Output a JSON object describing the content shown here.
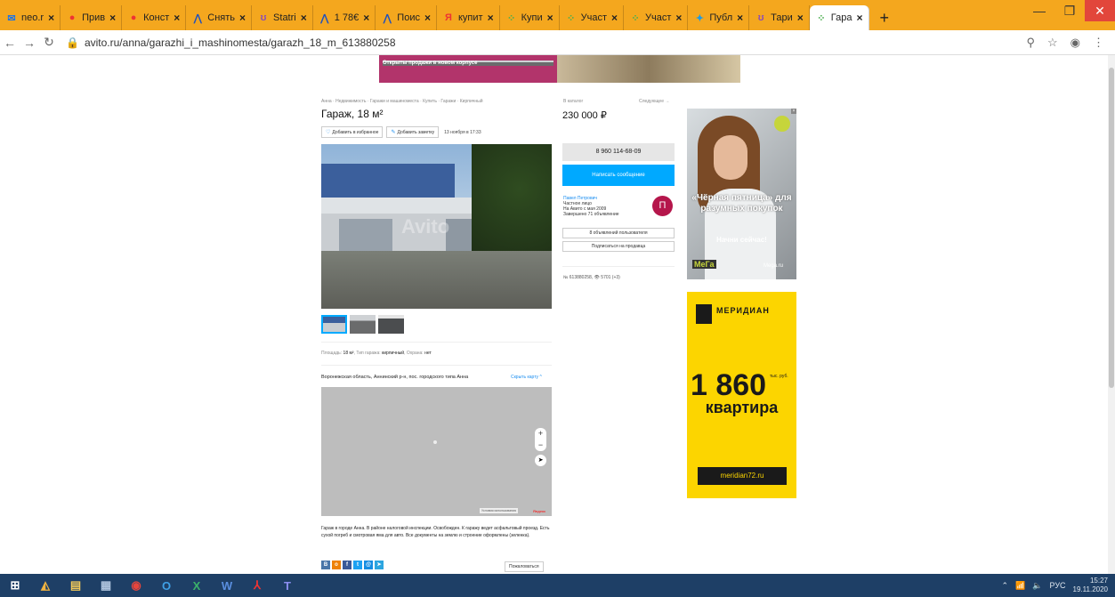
{
  "tabs": [
    {
      "icon": "mail-icon",
      "label": "neo.r",
      "active": false
    },
    {
      "icon": "pin-icon",
      "label": "Прив",
      "active": false
    },
    {
      "icon": "pin-icon",
      "label": "Конст",
      "active": false
    },
    {
      "icon": "avito-icon",
      "label": "Снять",
      "active": false
    },
    {
      "icon": "statrix-icon",
      "label": "Statri",
      "active": false
    },
    {
      "icon": "avito-icon",
      "label": "1 78€",
      "active": false
    },
    {
      "icon": "avito-icon",
      "label": "Поис",
      "active": false
    },
    {
      "icon": "yandex-icon",
      "label": "купит",
      "active": false
    },
    {
      "icon": "dots-icon",
      "label": "Купи",
      "active": false
    },
    {
      "icon": "dots-icon",
      "label": "Участ",
      "active": false
    },
    {
      "icon": "dots-icon",
      "label": "Участ",
      "active": false
    },
    {
      "icon": "star-icon",
      "label": "Публ",
      "active": false
    },
    {
      "icon": "statrix-icon",
      "label": "Тари",
      "active": false
    },
    {
      "icon": "dots-icon",
      "label": "Гара",
      "active": true
    }
  ],
  "browser": {
    "url": "avito.ru/anna/garazhi_i_mashinomesta/garazh_18_m_613880258"
  },
  "banner": {
    "line1": "Открыты продажи в новом корпусе"
  },
  "listing": {
    "breadcrumb": "Анна · Недвижимость · Гаражи и машиноместа · Купить · Гаражи · Кирпичный",
    "title": "Гараж, 18 м²",
    "fav_label": "Добавить в избранное",
    "note_label": "Добавить заметку",
    "date": "13 ноября в 17:33",
    "photo_watermark": "Avito",
    "params_label1": "Площадь:",
    "params_value1": "18 м²",
    "params_label2": "Тип гаража:",
    "params_value2": "кирпичный",
    "params_label3": "Охрана:",
    "params_value3": "нет",
    "address": "Воронежская область, Аннинский р-н, пос. городского типа Анна",
    "hide_map": "Скрыть карту ^",
    "map_terms": "Условия использования",
    "map_logo": "Яндекс",
    "description": "Гараж в городе Анна. В районе налоговой инспекции. Освобожден. К гаражу ведет асфальтовый проезд. Есть сухой погреб и смотровая яма для авто. Все документы на землю и строение оформлены (зеленка).",
    "complain": "Пожаловаться"
  },
  "sidebar": {
    "catalog": "В каталог",
    "next": "Следующее →",
    "price": "230 000 ₽",
    "phone": "8 960 114-68-09",
    "message_btn": "Написать сообщение",
    "seller_name": "Павел Петрович",
    "seller_type": "Частное лицо",
    "seller_since": "На Авито с мая 2009",
    "seller_done": "Завершено 71 объявление",
    "avatar_letter": "П",
    "ads_btn": "8 объявлений пользователя",
    "subscribe_btn": "Подписаться на продавца",
    "ad_id": "№ 613880258, 👁 5701 (+3)"
  },
  "ads": {
    "mega_text": "«Чёрная пятница» для разумных покупок",
    "mega_cta": "Начни сейчас!",
    "mega_logo": "МеГа",
    "mega_domain": "Mega.ru",
    "meridian_brand": "МЕРИДИАН",
    "meridian_number": "1 860",
    "meridian_unit": "тыс. руб.",
    "meridian_word": "квартира",
    "meridian_site": "meridian72.ru"
  },
  "taskbar": {
    "lang": "РУС",
    "time": "15:27",
    "date": "19.11.2020"
  }
}
